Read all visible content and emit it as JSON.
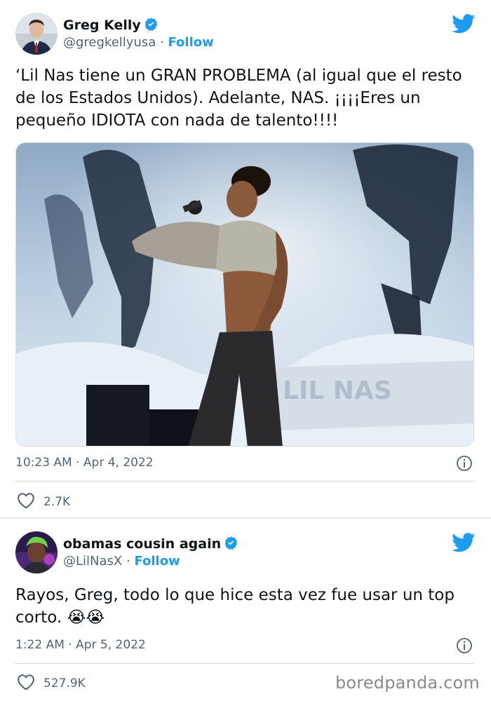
{
  "tweet1": {
    "display_name": "Greg Kelly",
    "handle": "@gregkellyusa",
    "separator": "·",
    "follow_label": "Follow",
    "text": "‘Lil Nas tiene un GRAN PROBLEMA (al igual que el resto\nde los Estados Unidos). Adelante, NAS. ¡¡¡¡Eres un\npequeño IDIOTA con nada de talento!!!!",
    "time": "10:23 AM · Apr 4, 2022",
    "likes": "2.7K"
  },
  "tweet2": {
    "display_name": "obamas cousin again",
    "handle": "@LilNasX",
    "separator": "·",
    "follow_label": "Follow",
    "text": "Rayos, Greg, todo lo que hice esta vez fue usar un top\ncorto. 😭😭",
    "time": "1:22 AM · Apr 5, 2022",
    "likes": "527.9K"
  },
  "watermark": "boredpanda.com",
  "icons": {
    "verified": "verified-badge-icon",
    "brand": "twitter-bird-icon",
    "info": "info-icon",
    "like": "heart-icon"
  },
  "colors": {
    "accent": "#1d9bf0",
    "text": "#0f1419",
    "muted": "#536471",
    "divider": "#cfd9de"
  }
}
